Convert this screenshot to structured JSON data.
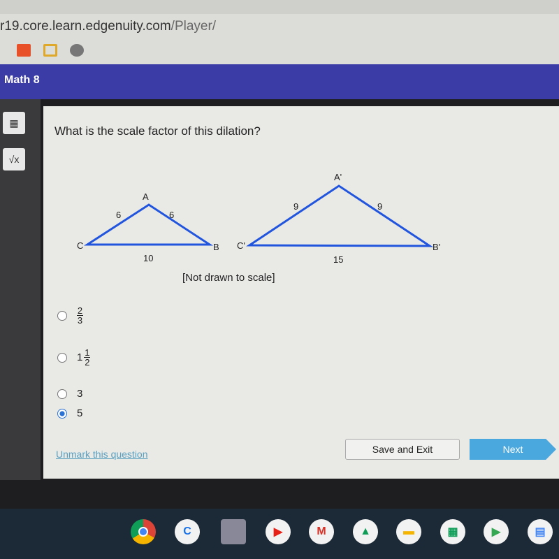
{
  "browser": {
    "url_host": "r19.core.learn.edgenuity.com",
    "url_path": "/Player/",
    "bookmarks": [
      {
        "icon": "soundcloud-icon",
        "color": "#e8502a"
      },
      {
        "icon": "slides-icon",
        "color": "#e0a82a"
      },
      {
        "icon": "globe-icon",
        "color": "#777777"
      }
    ]
  },
  "header": {
    "course": "Math 8",
    "color": "#3c3ca6"
  },
  "question": {
    "text": "What is the scale factor of this dilation?",
    "note": "[Not drawn to scale]"
  },
  "figure": {
    "small": {
      "A": "A",
      "B": "B",
      "C": "C",
      "CA": "6",
      "AB": "6",
      "CB": "10"
    },
    "large": {
      "A": "A'",
      "B": "B'",
      "C": "C'",
      "CA": "9",
      "AB": "9",
      "CB": "15"
    },
    "line_color": "#2255dd"
  },
  "options": [
    {
      "num": "2",
      "den": "3",
      "selected": false
    },
    {
      "whole": "1",
      "num": "1",
      "den": "2",
      "selected": false
    },
    {
      "label": "3",
      "selected": false
    },
    {
      "label": "5",
      "selected": true
    }
  ],
  "footer": {
    "unmark": "Unmark this question",
    "save": "Save and Exit",
    "next": "Next"
  },
  "shelf": [
    "chrome",
    "C",
    "app",
    "youtube",
    "gmail",
    "drive",
    "slides",
    "sheets",
    "play",
    "docs"
  ]
}
